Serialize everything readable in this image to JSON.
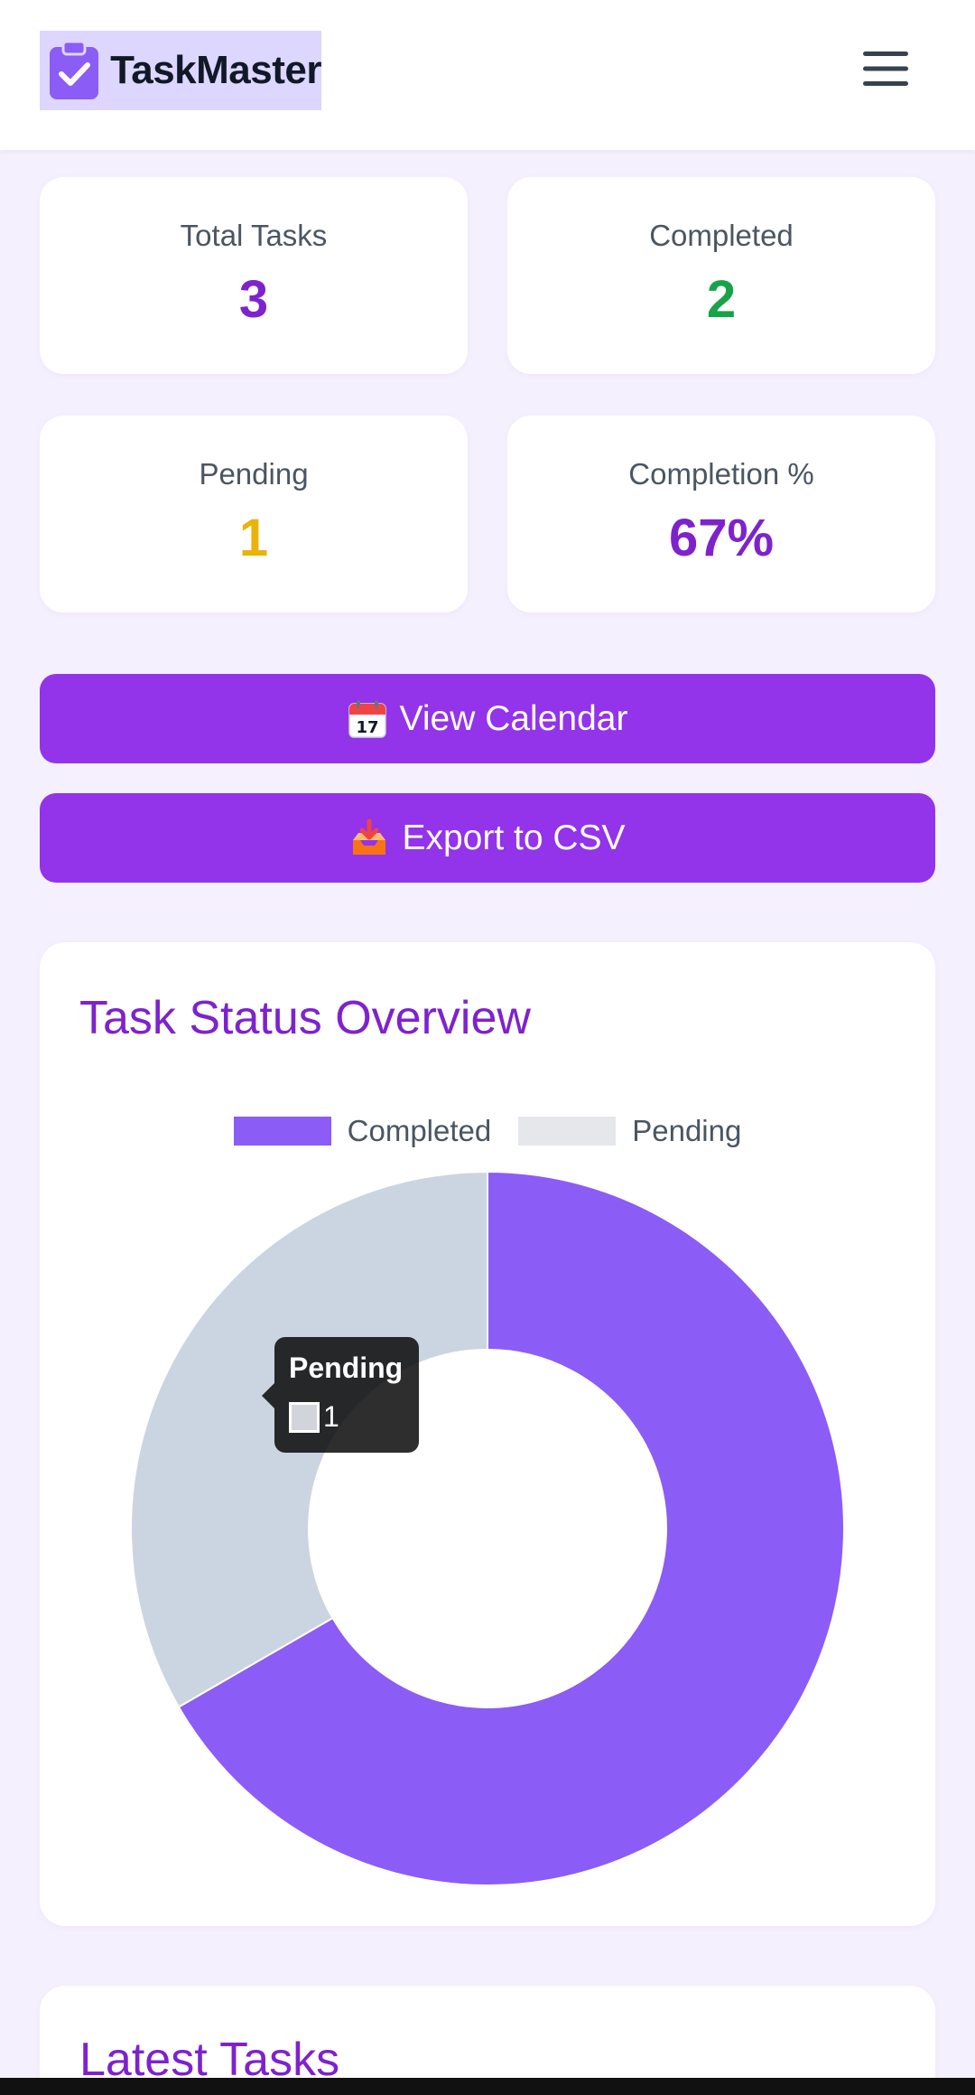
{
  "header": {
    "app_name": "TaskMaster",
    "logo_icon": "clipboard-check-icon",
    "menu_icon": "hamburger-menu-icon"
  },
  "stats": {
    "total": {
      "label": "Total Tasks",
      "value": "3",
      "color": "#7e22ce"
    },
    "completed": {
      "label": "Completed",
      "value": "2",
      "color": "#16a34a"
    },
    "pending": {
      "label": "Pending",
      "value": "1",
      "color": "#eab308"
    },
    "completion": {
      "label": "Completion %",
      "value": "67%",
      "color": "#7e22ce"
    }
  },
  "actions": {
    "calendar": {
      "label": "View Calendar",
      "icon": "calendar-icon"
    },
    "export": {
      "label": "Export to CSV",
      "icon": "inbox-tray-icon"
    }
  },
  "overview": {
    "title": "Task Status Overview",
    "tooltip": {
      "title": "Pending",
      "value": "1"
    }
  },
  "chart_data": {
    "type": "pie",
    "variant": "doughnut",
    "categories": [
      "Completed",
      "Pending"
    ],
    "values": [
      2,
      1
    ],
    "colors": [
      "#8b5cf6",
      "#cbd5e1"
    ],
    "legend_colors": [
      "#8b5cf6",
      "#e5e7eb"
    ],
    "legend": "top-center"
  },
  "latest": {
    "title": "Latest Tasks"
  }
}
